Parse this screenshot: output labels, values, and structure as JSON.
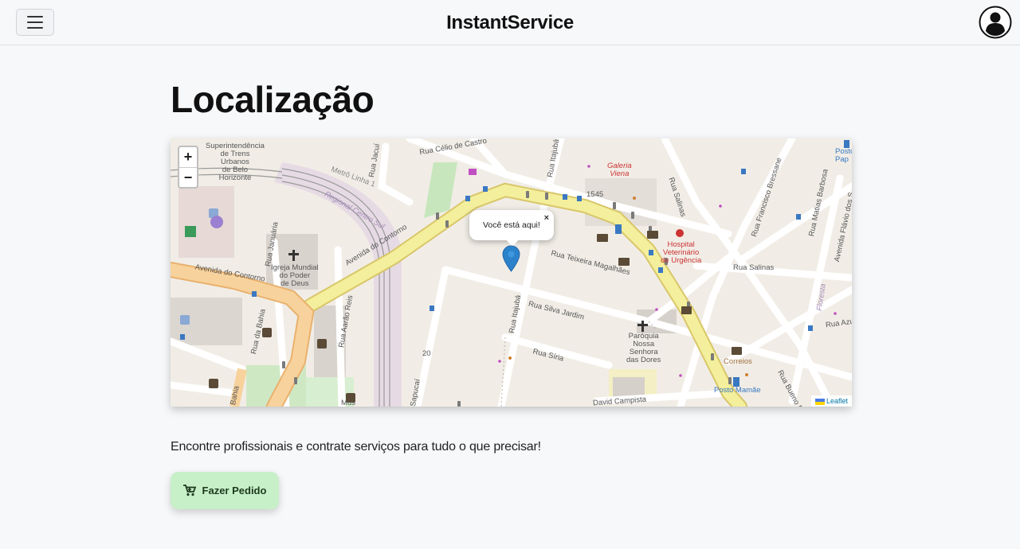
{
  "header": {
    "brand": "InstantService",
    "menu_icon": "hamburger-icon",
    "user_icon": "user-circle-icon"
  },
  "main": {
    "title": "Localização",
    "tagline": "Encontre profissionais e contrate serviços para tudo o que precisar!",
    "order_button": {
      "label": "Fazer Pedido",
      "icon": "cart-icon"
    }
  },
  "map": {
    "zoom_in": "+",
    "zoom_out": "−",
    "popup_text": "Você está aqui!",
    "popup_close": "×",
    "attribution": "Leaflet",
    "labels": {
      "superintendencia": "Superintendência\nde Trens\nUrbanos\nde Belo\nHorizonte",
      "rua_celio_de_castro": "Rua Célio de Castro",
      "rua_jacui": "Rua Jacuí",
      "rua_itajuba_top": "Rua Itajubá",
      "rua_itajuba_mid": "Rua Itajubá",
      "galeria_viena": "Galeria\nViena",
      "rua_salinas_top": "Rua Salinas",
      "rua_salinas_right": "Rua Salinas",
      "rua_francisco_bressane": "Rua Francisco Bressane",
      "rua_matias_barbosa": "Rua Matias Barbosa",
      "avenida_flavio": "Avenida Flávio dos S",
      "posto_top": "Posto\nPap",
      "metropolitano": "Metrô Linha 1",
      "regional_centro_sul": "Regional Centro Sul",
      "num_1545": "1545",
      "hospital": "Hospital\nVeterinário\nde Urgência",
      "rua_januaria": "Rua Januária",
      "igreja": "Igreja Mundial\ndo Poder\nde Deus",
      "avenida_do_contorno_diag": "Avenida do Contorno",
      "avenida_do_contorno_left": "Avenida do Contorno",
      "rua_teixeira": "Rua Teixeira Magalhães",
      "rua_silva_jardim": "Rua Silva Jardim",
      "paroquia": "Paróquia\nNossa\nSenhora\ndas Dores",
      "rua_siria": "Rua Síria",
      "rua_da_bahia": "Rua da Bahia",
      "rua_aarao_reis": "Rua Aarão Reis",
      "bahia": "Bahia",
      "num_20": "20",
      "sapucai": "Sapucaí",
      "museu": "Mus",
      "david_campista": "David Campista",
      "correios": "Correios",
      "posto_mamae": "Posto Mamãe",
      "rua_bueno_brandao": "Rua Bueno Bra",
      "rua_azul": "Rua Azu",
      "floresta": "Floresta"
    }
  }
}
